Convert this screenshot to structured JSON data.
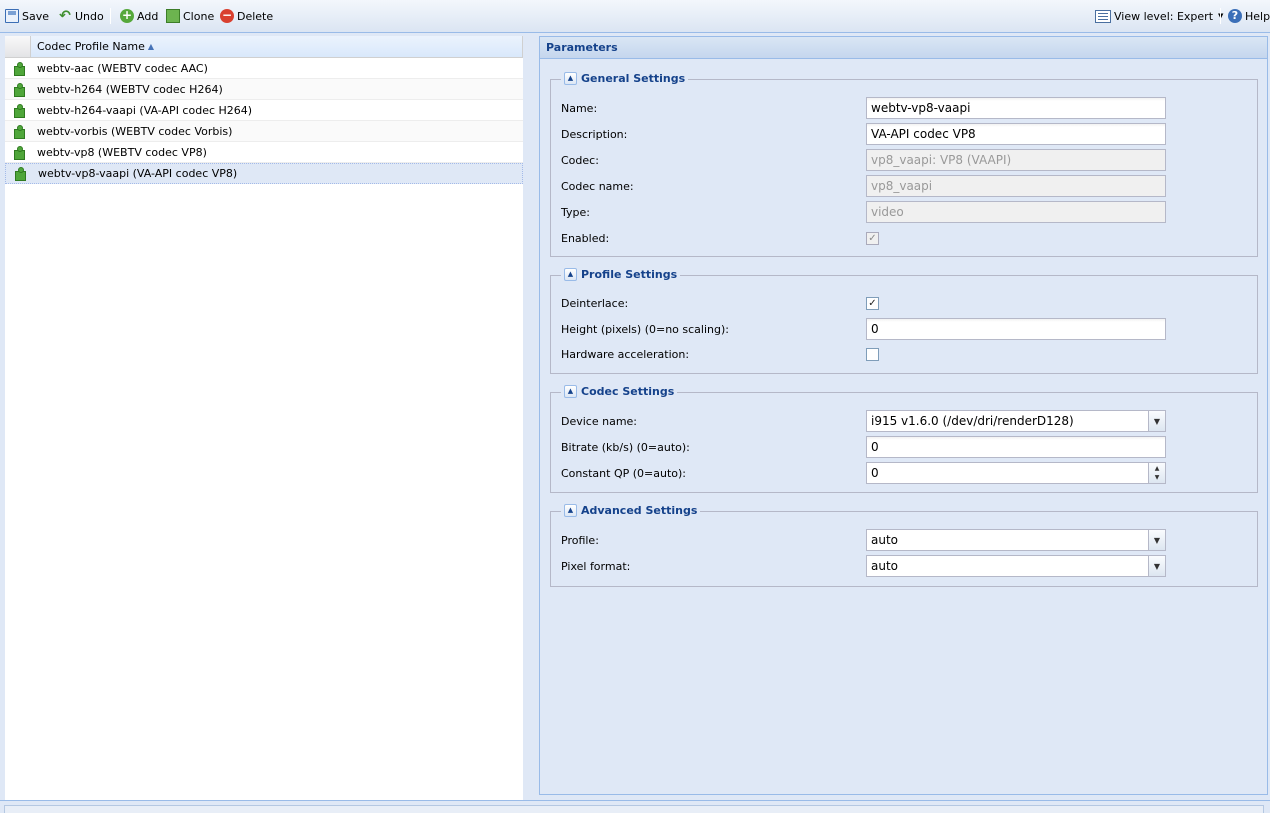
{
  "toolbar": {
    "save": "Save",
    "undo": "Undo",
    "add": "Add",
    "clone": "Clone",
    "delete": "Delete",
    "view_level": "View level: Expert",
    "help": "Help"
  },
  "grid": {
    "column_header": "Codec Profile Name",
    "rows": [
      "webtv-aac (WEBTV codec AAC)",
      "webtv-h264 (WEBTV codec H264)",
      "webtv-h264-vaapi (VA-API codec H264)",
      "webtv-vorbis (WEBTV codec Vorbis)",
      "webtv-vp8 (WEBTV codec VP8)",
      "webtv-vp8-vaapi (VA-API codec VP8)"
    ],
    "selected_index": 5
  },
  "panel": {
    "title": "Parameters",
    "general": {
      "legend": "General Settings",
      "name_label": "Name:",
      "name_value": "webtv-vp8-vaapi",
      "description_label": "Description:",
      "description_value": "VA-API codec VP8",
      "codec_label": "Codec:",
      "codec_value": "vp8_vaapi: VP8 (VAAPI)",
      "codec_name_label": "Codec name:",
      "codec_name_value": "vp8_vaapi",
      "type_label": "Type:",
      "type_value": "video",
      "enabled_label": "Enabled:",
      "enabled_checked": true
    },
    "profile": {
      "legend": "Profile Settings",
      "deinterlace_label": "Deinterlace:",
      "deinterlace_checked": true,
      "height_label": "Height (pixels) (0=no scaling):",
      "height_value": "0",
      "hwaccel_label": "Hardware acceleration:",
      "hwaccel_checked": false
    },
    "codec": {
      "legend": "Codec Settings",
      "device_label": "Device name:",
      "device_value": "i915 v1.6.0 (/dev/dri/renderD128)",
      "bitrate_label": "Bitrate (kb/s) (0=auto):",
      "bitrate_value": "0",
      "qp_label": "Constant QP (0=auto):",
      "qp_value": "0"
    },
    "advanced": {
      "legend": "Advanced Settings",
      "profile_label": "Profile:",
      "profile_value": "auto",
      "pixfmt_label": "Pixel format:",
      "pixfmt_value": "auto"
    }
  }
}
